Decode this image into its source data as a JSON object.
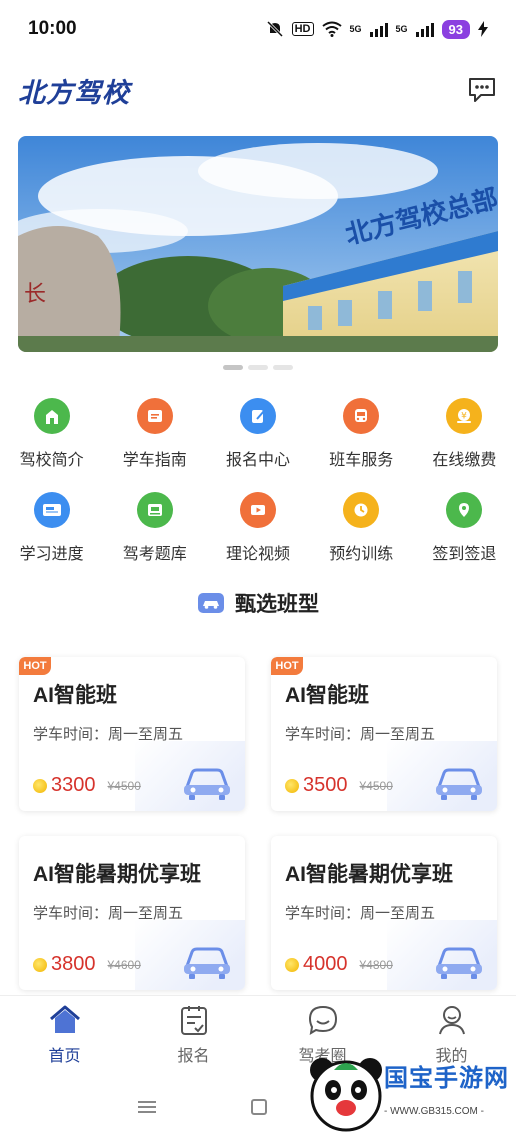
{
  "status_bar": {
    "time": "10:00",
    "battery": "93",
    "network_1": "5G",
    "network_2": "5G",
    "hd": "HD"
  },
  "header": {
    "title": "北方驾校",
    "message_icon": "message-icon"
  },
  "banner": {
    "sign_text": "北方驾校总部",
    "rock_text": "长",
    "slides": 3,
    "active_slide": 1
  },
  "grid": [
    {
      "label": "驾校简介",
      "icon": "school-icon",
      "color": "#4cb84c"
    },
    {
      "label": "学车指南",
      "icon": "guide-icon",
      "color": "#f0703a"
    },
    {
      "label": "报名中心",
      "icon": "signup-icon",
      "color": "#3c8ef0"
    },
    {
      "label": "班车服务",
      "icon": "bus-icon",
      "color": "#f0703a"
    },
    {
      "label": "在线缴费",
      "icon": "payment-icon",
      "color": "#f5b21c"
    },
    {
      "label": "学习进度",
      "icon": "progress-icon",
      "color": "#3c8ef0"
    },
    {
      "label": "驾考题库",
      "icon": "question-bank-icon",
      "color": "#4cb84c"
    },
    {
      "label": "理论视频",
      "icon": "video-icon",
      "color": "#f0703a"
    },
    {
      "label": "预约训练",
      "icon": "booking-icon",
      "color": "#f5b21c"
    },
    {
      "label": "签到签退",
      "icon": "checkin-icon",
      "color": "#4cb84c"
    }
  ],
  "section": {
    "title": "甄选班型"
  },
  "cards": [
    {
      "badge": "HOT",
      "title": "AI智能班",
      "time": "学车时间：周一至周五",
      "price": "3300",
      "original": "¥4500"
    },
    {
      "badge": "HOT",
      "title": "AI智能班",
      "time": "学车时间：周一至周五",
      "price": "3500",
      "original": "¥4500"
    },
    {
      "badge": "",
      "title": "AI智能暑期优享班",
      "time": "学车时间：周一至周五",
      "price": "3800",
      "original": "¥4600"
    },
    {
      "badge": "",
      "title": "AI智能暑期优享班",
      "time": "学车时间：周一至周五",
      "price": "4000",
      "original": "¥4800"
    }
  ],
  "tabs": [
    {
      "label": "首页",
      "icon": "home-icon"
    },
    {
      "label": "报名",
      "icon": "signup-clipboard-icon"
    },
    {
      "label": "驾考圈",
      "icon": "chat-icon"
    },
    {
      "label": "我的",
      "icon": "profile-icon"
    }
  ],
  "watermark": {
    "text": "国宝手游网",
    "url": "- WWW.GB315.COM -"
  },
  "colors": {
    "brand": "#1f3f98",
    "price": "#d6332c",
    "hot": "#f37b3d"
  }
}
